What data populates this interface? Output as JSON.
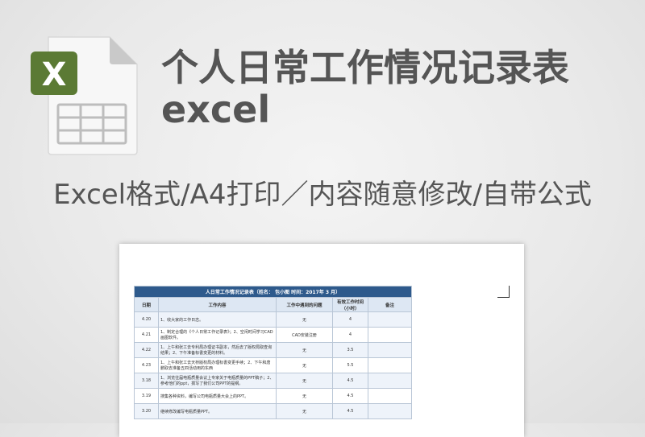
{
  "title": "个人日常工作情况记录表excel",
  "subtitle": "Excel格式/A4打印／内容随意修改/自带公式",
  "icon": {
    "name": "excel-file-icon",
    "letter": "X",
    "accent": "#5b7a34"
  },
  "sheet": {
    "table_title": "人日常工作情况记录表（姓名：  包小图      时间：2017年 3 月）",
    "headers": [
      "日期",
      "工作内容",
      "工作中遇到的问题",
      "有效工作时间（小时）",
      "备注"
    ],
    "rows": [
      {
        "date": "4.20",
        "content": "1、收大家的工作日志。",
        "problem": "无",
        "hours": "4",
        "note": ""
      },
      {
        "date": "4.21",
        "content": "1、制定合理的《个人日常工作记录表》；2、空闲时间学习CAD画图软件。",
        "problem": "CAD安装注册",
        "hours": "4",
        "note": ""
      },
      {
        "date": "4.22",
        "content": "1、上午和张工去专利局办理证书副本，然后去了版权局取查询结果；2、下午准备标書变更的材料。",
        "problem": "无",
        "hours": "3.5",
        "note": ""
      },
      {
        "date": "4.23",
        "content": "1、上午和张工去天桥版权局办理标書变更手续；2、下午和唐鹏取去准备五四活动用的东西",
        "problem": "无",
        "hours": "5.5",
        "note": ""
      },
      {
        "date": "3.18",
        "content": "1、浏览往届电瓶质量会议上专家关于电瓶质量的PPT稿子；2、参考他们的ppt，撰写了我们公司PPT的提纲。",
        "problem": "无",
        "hours": "4.5",
        "note": ""
      },
      {
        "date": "3.19",
        "content": "搜集各种资料，编写公司电瓶质量大会上的PPT。",
        "problem": "无",
        "hours": "4.5",
        "note": ""
      },
      {
        "date": "3.20",
        "content": "继续修改编写电瓶质量PPT。",
        "problem": "无",
        "hours": "4.5",
        "note": ""
      }
    ]
  }
}
